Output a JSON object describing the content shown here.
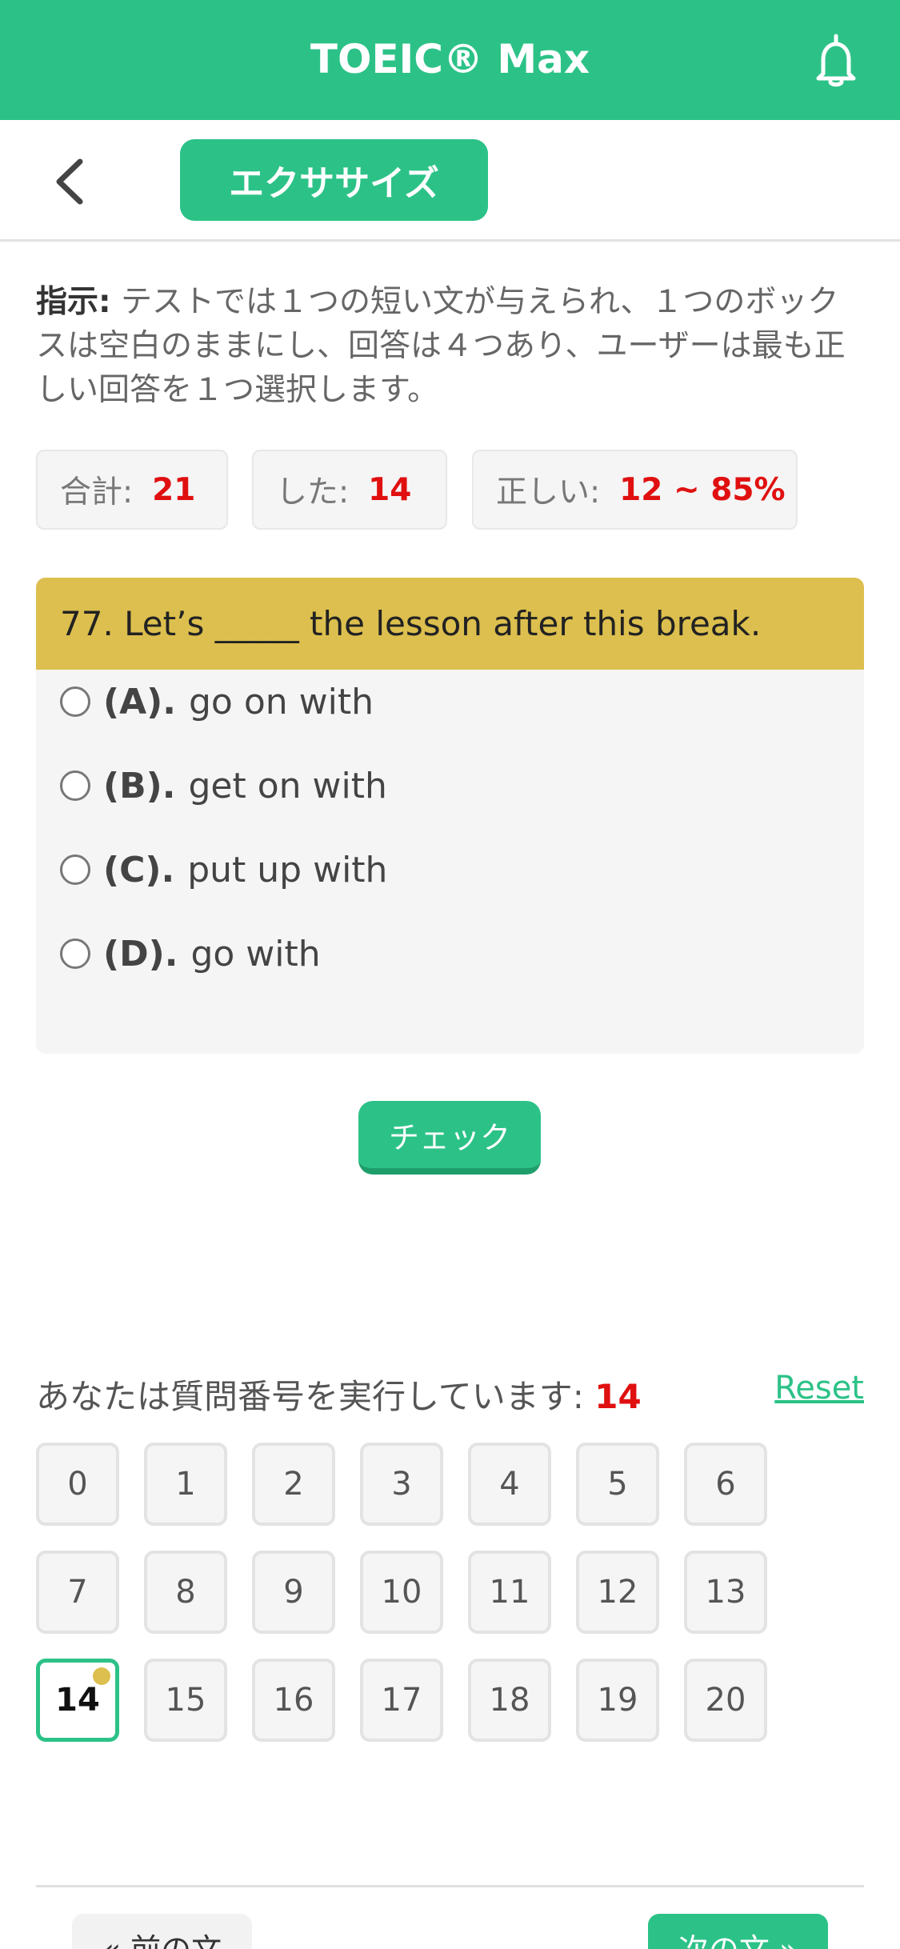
{
  "header": {
    "title": "TOEIC® Max",
    "icon": "bell-icon"
  },
  "subbar": {
    "back_icon": "chevron-left-icon",
    "tab_label": "エクササイズ"
  },
  "instructions": {
    "label": "指示:",
    "text": " テストでは１つの短い文が与えられ、１つのボックスは空白のままにし、回答は４つあり、ユーザーは最も正しい回答を１つ選択します。"
  },
  "stats": {
    "total_label": "合計:",
    "total_value": "21",
    "done_label": "した:",
    "done_value": "14",
    "correct_label": "正しい:",
    "correct_value": "12 ~ 85%"
  },
  "question": {
    "text": "77. Let’s _____ the lesson after this break.",
    "options": [
      {
        "letter": "(A).",
        "text": "go on with"
      },
      {
        "letter": "(B).",
        "text": "get on with"
      },
      {
        "letter": "(C).",
        "text": "put up with"
      },
      {
        "letter": "(D).",
        "text": "go with"
      }
    ]
  },
  "check_button": "チェック",
  "progress": {
    "label": "あなたは質問番号を実行しています: ",
    "current": "14",
    "reset": "Reset"
  },
  "question_numbers": [
    "0",
    "1",
    "2",
    "3",
    "4",
    "5",
    "6",
    "7",
    "8",
    "9",
    "10",
    "11",
    "12",
    "13",
    "14",
    "15",
    "16",
    "17",
    "18",
    "19",
    "20"
  ],
  "nav": {
    "prev": "« 前の文",
    "next": "次の文 »"
  },
  "colors": {
    "brand": "#2cc287",
    "question_header": "#dcbf4e",
    "highlight": "#e01010"
  }
}
